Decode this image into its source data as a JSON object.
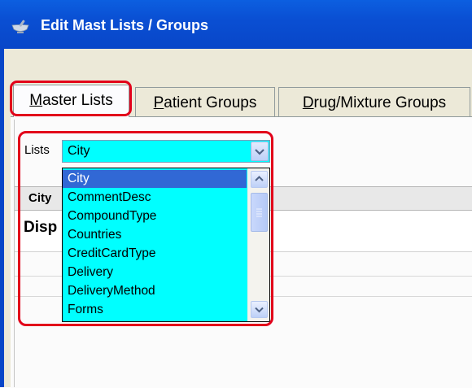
{
  "window": {
    "title": "Edit Mast Lists / Groups",
    "icon": "mortar-pestle-icon"
  },
  "tabs": [
    {
      "label": "Master Lists",
      "accel": "M",
      "rest": "aster Lists",
      "selected": true
    },
    {
      "label": "Patient Groups",
      "accel": "P",
      "rest": "atient Groups",
      "selected": false
    },
    {
      "label": "Drug/Mixture Groups",
      "accel": "D",
      "rest": "rug/Mixture Groups",
      "selected": false
    }
  ],
  "lists": {
    "label": "Lists",
    "selected_value": "City",
    "options": [
      "City",
      "CommentDesc",
      "CompoundType",
      "Countries",
      "CreditCardType",
      "Delivery",
      "DeliveryMethod",
      "Forms"
    ],
    "highlighted_index": 0
  },
  "grid": {
    "column_header": "City",
    "row_label": "Disp"
  },
  "colors": {
    "titlebar": "#0a4fd3",
    "highlight_outline": "#e2001a",
    "list_background": "#00ffff",
    "selection": "#3168d5"
  }
}
